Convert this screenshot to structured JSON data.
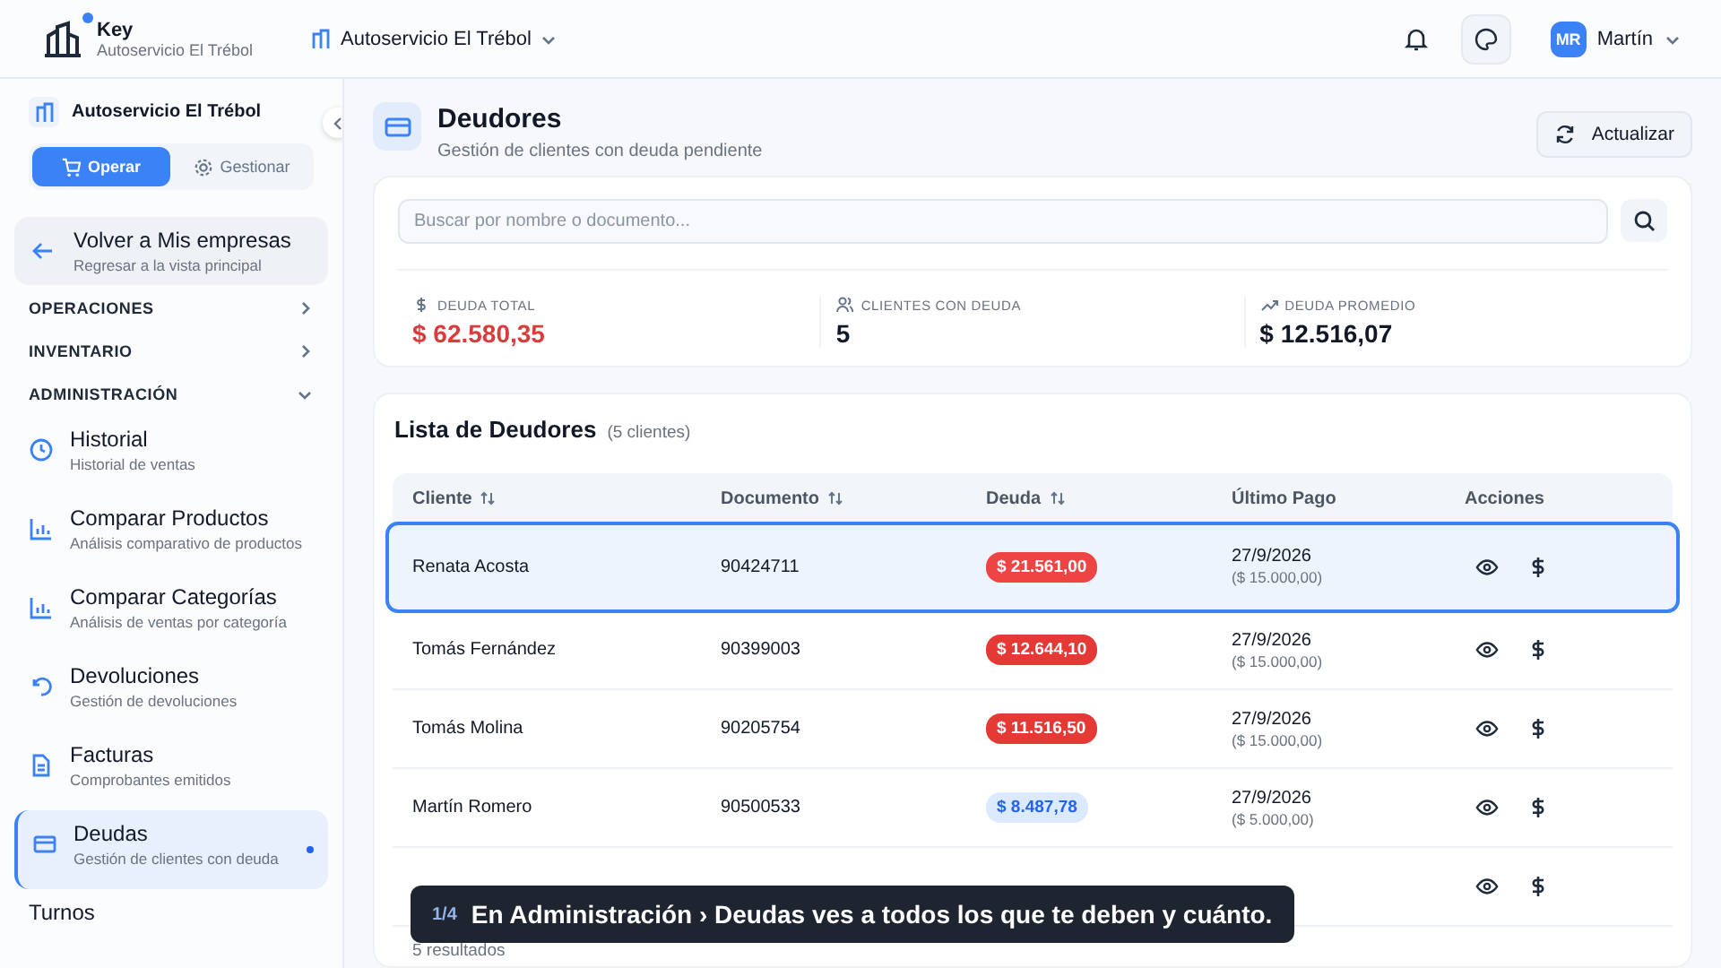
{
  "topbar": {
    "app_name": "Key",
    "app_company": "Autoservicio El Trébol",
    "company_selector": "Autoservicio El Trébol",
    "user": {
      "initials": "MR",
      "name": "Martín"
    },
    "notification_dot": true
  },
  "sidebar": {
    "company": "Autoservicio El Trébol",
    "modes": [
      {
        "label": "Operar",
        "selected": true
      },
      {
        "label": "Gestionar",
        "selected": false
      }
    ],
    "back": {
      "title": "Volver a Mis empresas",
      "subtitle": "Regresar a la vista principal"
    },
    "sections": [
      {
        "label": "OPERACIONES",
        "expanded": false
      },
      {
        "label": "INVENTARIO",
        "expanded": false
      },
      {
        "label": "ADMINISTRACIÓN",
        "expanded": true,
        "items": [
          {
            "kind": "clock",
            "title": "Historial",
            "subtitle": "Historial de ventas",
            "selected": false
          },
          {
            "kind": "chart",
            "title": "Comparar Productos",
            "subtitle": "Análisis comparativo de productos",
            "selected": false
          },
          {
            "kind": "chart",
            "title": "Comparar Categorías",
            "subtitle": "Análisis de ventas por categoría",
            "selected": false
          },
          {
            "kind": "undo",
            "title": "Devoluciones",
            "subtitle": "Gestión de devoluciones",
            "selected": false
          },
          {
            "kind": "file",
            "title": "Facturas",
            "subtitle": "Comprobantes emitidos",
            "selected": false
          },
          {
            "kind": "card",
            "title": "Deudas",
            "subtitle": "Gestión de clientes con deuda",
            "selected": true
          },
          {
            "kind": "none",
            "title": "Turnos",
            "selected": false
          }
        ]
      }
    ]
  },
  "page": {
    "title": "Deudores",
    "subtitle": "Gestión de clientes con deuda pendiente",
    "refresh_button": "Actualizar"
  },
  "search": {
    "placeholder": "Buscar por nombre o documento..."
  },
  "stats": [
    {
      "kind": "dollar",
      "label": "DEUDA TOTAL",
      "value": "$ 62.580,35",
      "color": "#dc3b3b"
    },
    {
      "kind": "users",
      "label": "CLIENTES CON DEUDA",
      "value": "5",
      "color": "#111827"
    },
    {
      "kind": "trend",
      "label": "DEUDA PROMEDIO",
      "value": "$ 12.516,07",
      "color": "#111827"
    }
  ],
  "table": {
    "title": "Lista de Deudores",
    "count": "(5 clientes)",
    "columns": [
      {
        "label": "Cliente",
        "sortable": true
      },
      {
        "label": "Documento",
        "sortable": true
      },
      {
        "label": "Deuda",
        "sortable": true
      },
      {
        "label": "Último Pago",
        "sortable": false
      },
      {
        "label": "Acciones",
        "sortable": false
      }
    ],
    "rows": [
      {
        "client": "Renata Acosta",
        "document": "90424711",
        "debt": "$ 21.561,00",
        "color": "#ef4444",
        "last_date": "27/9/2026",
        "last_amount": "($ 15.000,00)",
        "selected": true
      },
      {
        "client": "Tomás Fernández",
        "document": "90399003",
        "debt": "$ 12.644,10",
        "color": "#e53935",
        "last_date": "27/9/2026",
        "last_amount": "($ 15.000,00)",
        "selected": false
      },
      {
        "client": "Tomás Molina",
        "document": "90205754",
        "debt": "$ 11.516,50",
        "color": "#e53935",
        "last_date": "27/9/2026",
        "last_amount": "($ 15.000,00)",
        "selected": false
      },
      {
        "client": "Martín Romero",
        "document": "90500533",
        "debt": "$ 8.487,78",
        "color": "#dbeafe",
        "last_date": "27/9/2026",
        "last_amount": "($ 5.000,00)",
        "selected": false
      },
      {
        "selected": false
      }
    ],
    "footer": "5 resultados"
  },
  "caption": {
    "step": "1/4",
    "text": "En Administración › Deudas ves a todos los que te deben y cuánto."
  }
}
